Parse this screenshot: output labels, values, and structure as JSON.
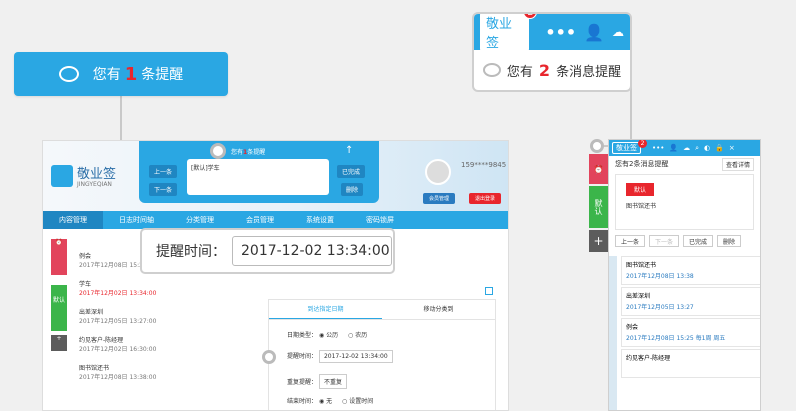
{
  "big_reminder": {
    "prefix": "您有",
    "count": "1",
    "suffix": "条提醒"
  },
  "widget": {
    "brand": "敬业签",
    "badge": "2",
    "more": "•••",
    "prefix": "您有",
    "count": "2",
    "suffix": "条消息提醒"
  },
  "app": {
    "logo_title": "敬业签",
    "logo_sub": "JINGYEQIAN",
    "popup": {
      "prefix": "您有",
      "count": "1",
      "suffix": "条提醒",
      "box_text": "[默认]学车",
      "prev": "上一条",
      "next": "下一条",
      "done": "已完成",
      "delete": "删除"
    },
    "phone": "159****9845",
    "member_btn": "会员管理",
    "logout_btn": "退出登录",
    "nav": [
      "内容管理",
      "日志时间轴",
      "分类管理",
      "会员管理",
      "系统设置",
      "密码锁屏"
    ],
    "side_tabs": {
      "default": "默认"
    },
    "list": [
      {
        "title": "例会",
        "date": "2017年12月08日 15:25..."
      },
      {
        "title": "学车",
        "date": "2017年12月02日 13:34:00",
        "red": true
      },
      {
        "title": "出差深圳",
        "date": "2017年12月05日 13:27:00"
      },
      {
        "title": "约见客户-陈经理",
        "date": "2017年12月02日 16:30:00"
      },
      {
        "title": "图书馆还书",
        "date": "2017年12月08日 13:38:00"
      }
    ],
    "form": {
      "tab1": "到达指定日期",
      "tab2": "移动分类到",
      "date_type_label": "日期类型：",
      "gregorian": "公历",
      "lunar": "农历",
      "remind_label": "提醒时间：",
      "remind_value": "2017-12-02 13:34:00",
      "repeat_label": "重复提醒：",
      "repeat_value": "不重复",
      "end_label": "结束时间：",
      "end_none": "无",
      "end_set": "设置时间"
    }
  },
  "time_callout": {
    "label": "提醒时间：",
    "value": "2017-12-02 13:34:00"
  },
  "right_widget": {
    "brand": "敬业签",
    "badge": "2",
    "sub": "您有2条消息提醒",
    "view": "查看详情",
    "tag": "默认",
    "msg": "图书馆还书",
    "prev": "上一条",
    "next": "下一条",
    "done": "已完成",
    "delete": "删除",
    "side_tab": "默认",
    "items": [
      {
        "title": "图书馆还书",
        "date": "2017年12月08日 13:38"
      },
      {
        "title": "出差深圳",
        "date": "2017年12月05日 13:27"
      },
      {
        "title": "例会",
        "date": "2017年12月08日 15:25 每1周 周五"
      },
      {
        "title": "约见客户-陈经理",
        "date": ""
      }
    ]
  },
  "colors": {
    "accent": "#2aa7e3",
    "red": "#e8262d",
    "green": "#3bb54a",
    "dark": "#5c5c5c"
  }
}
